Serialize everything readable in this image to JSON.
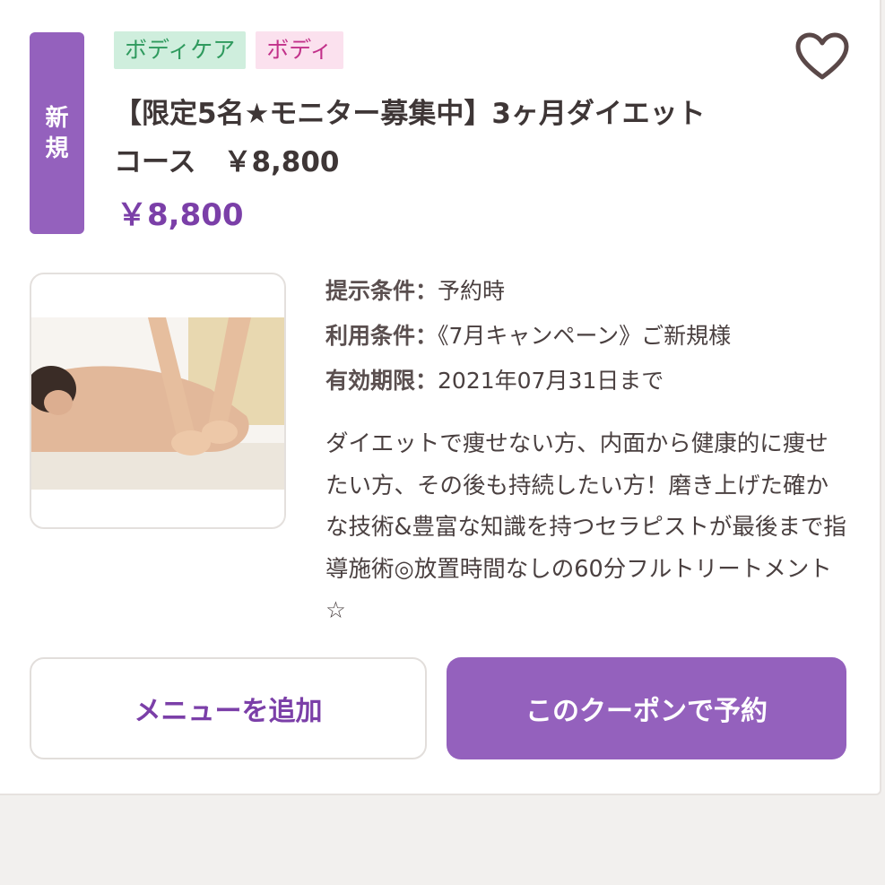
{
  "coupon": {
    "new_badge": [
      "新",
      "規"
    ],
    "tags": [
      {
        "label": "ボディケア",
        "color": "#2f9a5e",
        "bg": "#cfeedd"
      },
      {
        "label": "ボディ",
        "color": "#c2318a",
        "bg": "#fbe1ee"
      }
    ],
    "favorite_icon": "heart-outline-icon",
    "title_line1": "【限定5名★モニター募集中】3ヶ月ダイエット",
    "title_line2": "コース　￥8,800",
    "price": "￥8,800",
    "details": [
      {
        "label": "提示条件：",
        "value": "予約時"
      },
      {
        "label": "利用条件：",
        "value": "《7月キャンペーン》ご新規様"
      },
      {
        "label": "有効期限：",
        "value": "2021年07月31日まで"
      }
    ],
    "description": "ダイエットで痩せない方、内面から健康的に痩せたい方、その後も持続したい方！磨き上げた確かな技術&豊富な知識を持つセラピストが最後まで指導施術◎放置時間なしの60分フルトリートメント☆"
  },
  "buttons": {
    "add_menu": "メニューを追加",
    "reserve": "このクーポンで予約"
  },
  "colors": {
    "accent": "#9461bd",
    "price": "#7b3fa8",
    "background": "#f2f0ee"
  }
}
